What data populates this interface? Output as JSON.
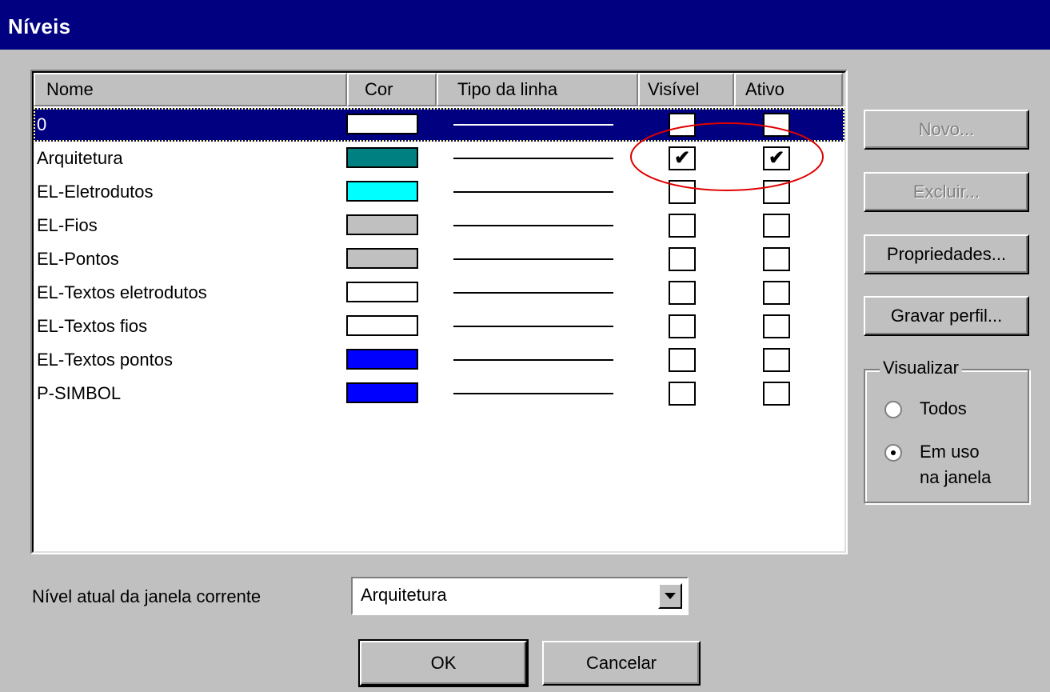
{
  "window": {
    "title": "Níveis"
  },
  "columns": {
    "name": "Nome",
    "color": "Cor",
    "linetype": "Tipo da linha",
    "visible": "Visível",
    "active": "Ativo"
  },
  "levels": [
    {
      "name": "0",
      "color": "#ffffff",
      "visible": false,
      "active": false,
      "selected": true
    },
    {
      "name": "Arquitetura",
      "color": "#008080",
      "visible": true,
      "active": true,
      "selected": false
    },
    {
      "name": "EL-Eletrodutos",
      "color": "#00ffff",
      "visible": false,
      "active": false,
      "selected": false
    },
    {
      "name": "EL-Fios",
      "color": "#c0c0c0",
      "visible": false,
      "active": false,
      "selected": false
    },
    {
      "name": "EL-Pontos",
      "color": "#c0c0c0",
      "visible": false,
      "active": false,
      "selected": false
    },
    {
      "name": "EL-Textos eletrodutos",
      "color": "#ffffff",
      "visible": false,
      "active": false,
      "selected": false
    },
    {
      "name": "EL-Textos fios",
      "color": "#ffffff",
      "visible": false,
      "active": false,
      "selected": false
    },
    {
      "name": "EL-Textos pontos",
      "color": "#0000ff",
      "visible": false,
      "active": false,
      "selected": false
    },
    {
      "name": "P-SIMBOL",
      "color": "#0000ff",
      "visible": false,
      "active": false,
      "selected": false
    }
  ],
  "buttons": {
    "novo": "Novo...",
    "excluir": "Excluir...",
    "propriedades": "Propriedades...",
    "gravar": "Gravar perfil...",
    "ok": "OK",
    "cancelar": "Cancelar"
  },
  "visualizar": {
    "legend": "Visualizar",
    "option_todos": "Todos",
    "option_emuso_1": "Em uso",
    "option_emuso_2": "na janela",
    "selected": "em_uso"
  },
  "current_level": {
    "label": "Nível atual da janela corrente",
    "value": "Arquitetura"
  },
  "colors": {
    "title_bar": "#000080",
    "face": "#c0c0c0",
    "annotation": "#e00000"
  }
}
